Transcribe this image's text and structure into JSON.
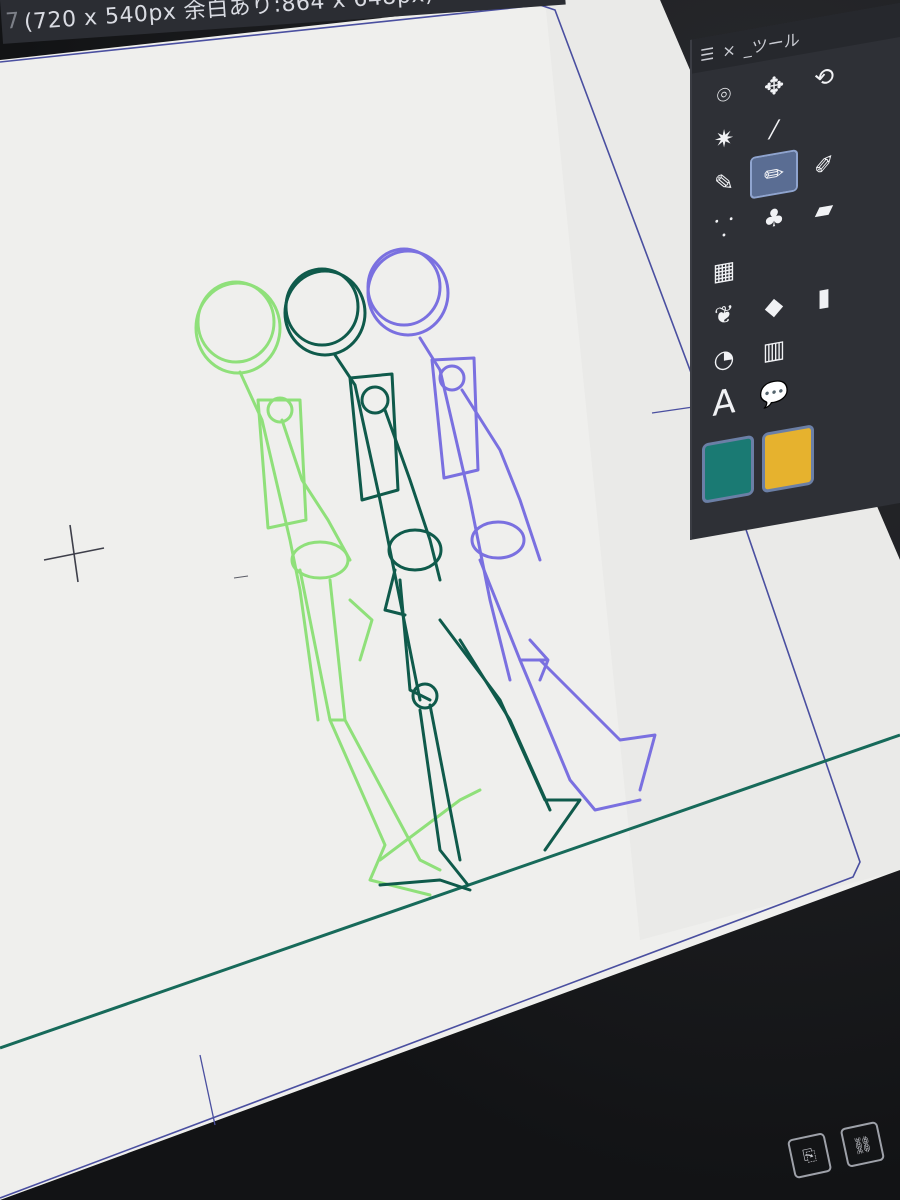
{
  "window": {
    "title_prefix": "7",
    "title_text": "(720 x 540px 余白あり:864 x 648px)"
  },
  "tool_panel": {
    "menu_icon": "menu-icon",
    "close_label": "×",
    "title": "_ツール",
    "tools": [
      {
        "name": "lasso-tool",
        "glyph": "⌾",
        "active": false
      },
      {
        "name": "move-tool",
        "glyph": "✥",
        "active": false
      },
      {
        "name": "rotate-tool",
        "glyph": "⟲",
        "active": false
      },
      {
        "name": "blank",
        "glyph": "",
        "active": false
      },
      {
        "name": "magic-wand-tool",
        "glyph": "✷",
        "active": false
      },
      {
        "name": "eyedropper-tool",
        "glyph": "⁄",
        "active": false
      },
      {
        "name": "blank",
        "glyph": "",
        "active": false
      },
      {
        "name": "blank",
        "glyph": "",
        "active": false
      },
      {
        "name": "pen-tool",
        "glyph": "✎",
        "active": false
      },
      {
        "name": "pencil-tool",
        "glyph": "✏",
        "active": true
      },
      {
        "name": "brush-tool",
        "glyph": "✐",
        "active": false
      },
      {
        "name": "blank",
        "glyph": "",
        "active": false
      },
      {
        "name": "airbrush-tool",
        "glyph": "⸪",
        "active": false
      },
      {
        "name": "decoration-tool",
        "glyph": "♣",
        "active": false
      },
      {
        "name": "eraser-tool",
        "glyph": "▰",
        "active": false
      },
      {
        "name": "blank",
        "glyph": "",
        "active": false
      },
      {
        "name": "mesh-tool",
        "glyph": "▦",
        "active": false
      },
      {
        "name": "blank",
        "glyph": "",
        "active": false
      },
      {
        "name": "blank",
        "glyph": "",
        "active": false
      },
      {
        "name": "blank",
        "glyph": "",
        "active": false
      },
      {
        "name": "blend-tool",
        "glyph": "❦",
        "active": false
      },
      {
        "name": "fill-tool",
        "glyph": "◆",
        "active": false
      },
      {
        "name": "gradient-tool",
        "glyph": "▮",
        "active": false
      },
      {
        "name": "blank",
        "glyph": "",
        "active": false
      },
      {
        "name": "shape-tool",
        "glyph": "◔",
        "active": false
      },
      {
        "name": "frame-tool",
        "glyph": "▥",
        "active": false
      },
      {
        "name": "blank",
        "glyph": "",
        "active": false
      },
      {
        "name": "blank",
        "glyph": "",
        "active": false
      },
      {
        "name": "text-tool",
        "glyph": "A",
        "active": false
      },
      {
        "name": "balloon-tool",
        "glyph": "💬",
        "active": false
      },
      {
        "name": "blank",
        "glyph": "",
        "active": false
      },
      {
        "name": "blank",
        "glyph": "",
        "active": false
      }
    ],
    "main_color": "#1a7a73",
    "sub_color": "#e6b22e"
  },
  "sketch": {
    "colors": {
      "figure_green": "#8fe07a",
      "figure_dark": "#0f5a4b",
      "figure_purple": "#7a70e0",
      "ground_line": "#176a5a",
      "frame_line": "#4a4fa0"
    }
  }
}
